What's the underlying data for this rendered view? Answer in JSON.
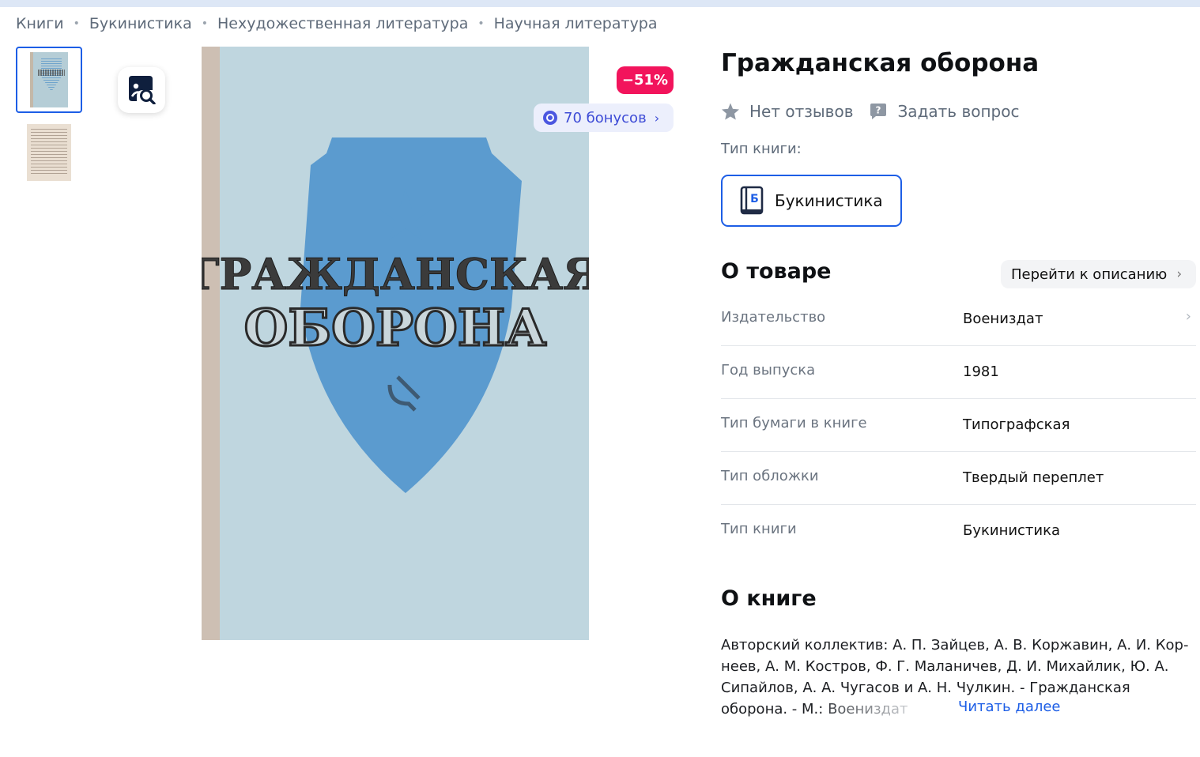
{
  "breadcrumb": [
    "Книги",
    "Букинистика",
    "Нехудожественная литература",
    "Научная литература"
  ],
  "product": {
    "title": "Гражданская оборона",
    "cover_text_line1": "ГРАЖДАНСКАЯ",
    "cover_text_line2": "ОБОРОНА",
    "discount": "−51%",
    "bonus_label": "70 бонусов",
    "reviews_label": "Нет отзывов",
    "question_label": "Задать вопрос",
    "type_label": "Тип книги:",
    "type_value": "Букинистика",
    "type_icon_letter": "Б"
  },
  "about": {
    "title": "О товаре",
    "goto_label": "Перейти к описанию",
    "specs": [
      {
        "key": "Издательство",
        "value": "Воениздат"
      },
      {
        "key": "Год выпуска",
        "value": "1981"
      },
      {
        "key": "Тип бумаги в книге",
        "value": "Типографская"
      },
      {
        "key": "Тип обложки",
        "value": "Твердый переплет"
      },
      {
        "key": "Тип книги",
        "value": "Букинистика"
      }
    ]
  },
  "book": {
    "title": "О книге",
    "desc_line1": "Авторский коллектив: А. П. Зайцев, А. В. Коржавин, А. И. Кор-",
    "desc_line2": "неев, А. М. Костров, Ф. Г. Маланичев, Д. И. Михайлик, Ю. А.",
    "desc_line3": "Сипайлов, А. А. Чугасов и А. Н. Чулкин. - Гражданская",
    "desc_line4_start": "оборона. - М.: ",
    "desc_line4_fade": "Воениздат",
    "read_more": "Читать далее"
  },
  "colors": {
    "accent": "#1d5ee6",
    "discount": "#f2145c",
    "bonus_text": "#3d4bd6"
  }
}
